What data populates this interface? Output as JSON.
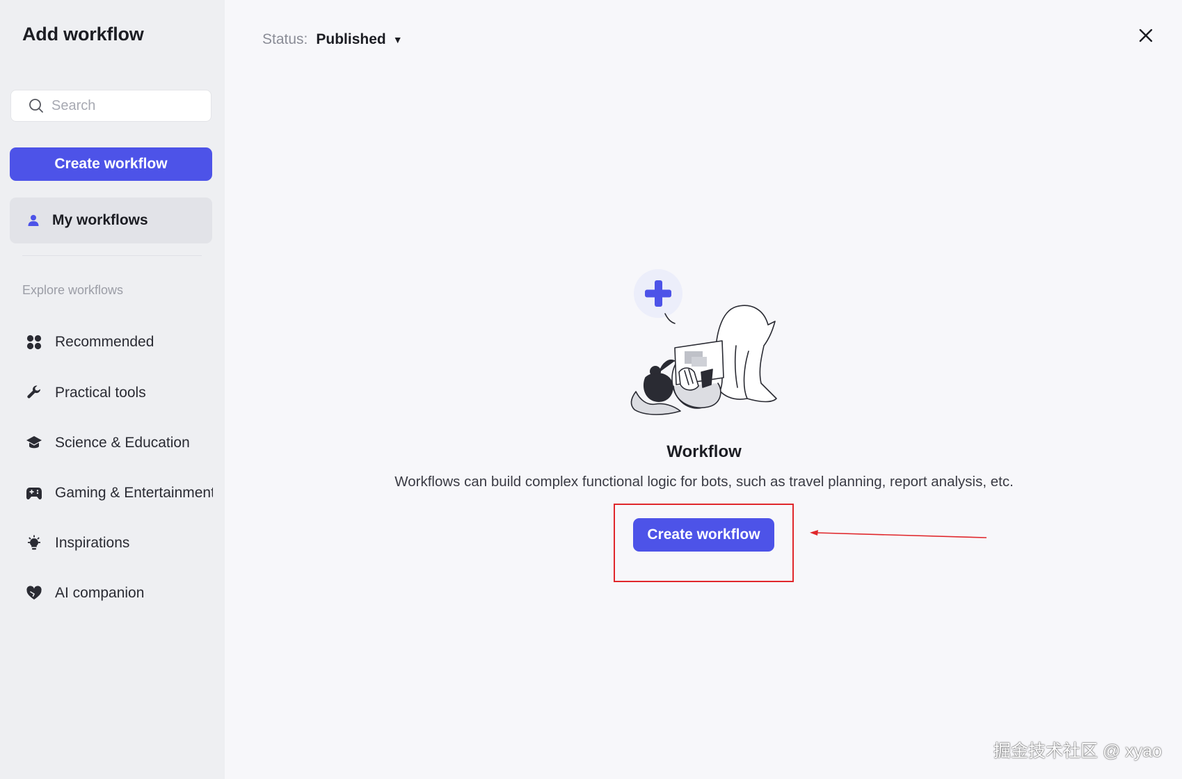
{
  "sidebar": {
    "title": "Add workflow",
    "search": {
      "placeholder": "Search",
      "value": ""
    },
    "create_button_label": "Create workflow",
    "my_workflows_label": "My workflows",
    "explore_label": "Explore workflows",
    "items": [
      {
        "label": "Recommended",
        "icon": "grid-icon"
      },
      {
        "label": "Practical tools",
        "icon": "wrench-icon"
      },
      {
        "label": "Science & Education",
        "icon": "graduation-cap-icon"
      },
      {
        "label": "Gaming & Entertainment",
        "icon": "gamepad-icon"
      },
      {
        "label": "Inspirations",
        "icon": "lightbulb-icon"
      },
      {
        "label": "AI companion",
        "icon": "heart-icon"
      }
    ]
  },
  "header": {
    "status_label": "Status:",
    "status_value": "Published"
  },
  "empty_state": {
    "title": "Workflow",
    "description": "Workflows can build complex functional logic for bots, such as travel planning, report analysis, etc.",
    "button_label": "Create workflow"
  },
  "watermark": "掘金技术社区 @ xyao",
  "colors": {
    "accent": "#4d53e8",
    "sidebar_bg": "#eeeff2",
    "main_bg": "#f7f7fa",
    "annotation": "#e0272b"
  }
}
